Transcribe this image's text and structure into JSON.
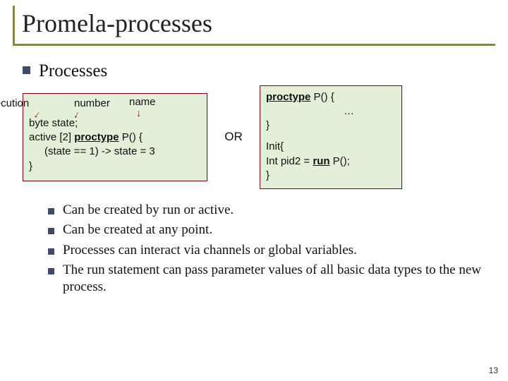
{
  "title": "Promela-processes",
  "subhead": "Processes",
  "left_annot": {
    "execution": "execution",
    "number": "number",
    "name": "name"
  },
  "left_code": {
    "l1": "byte state;",
    "l2a": "active [2] ",
    "l2b": "proctype",
    "l2c": " P() {",
    "l3": "(state == 1) -> state = 3",
    "l4": "}"
  },
  "or_label": "OR",
  "right_code": {
    "l1a": "proctype",
    "l1b": " P() {",
    "l2": "…",
    "l3": "}",
    "l4": "Init{",
    "l5a": "Int pid2 = ",
    "l5b": "run",
    "l5c": " P();",
    "l6": "}"
  },
  "bullets": [
    "Can be created by run or active.",
    "Can be created at any point.",
    "Processes can interact via channels or global variables.",
    "The run statement can pass parameter values of all basic data types to the new process."
  ],
  "pagenum": "13"
}
